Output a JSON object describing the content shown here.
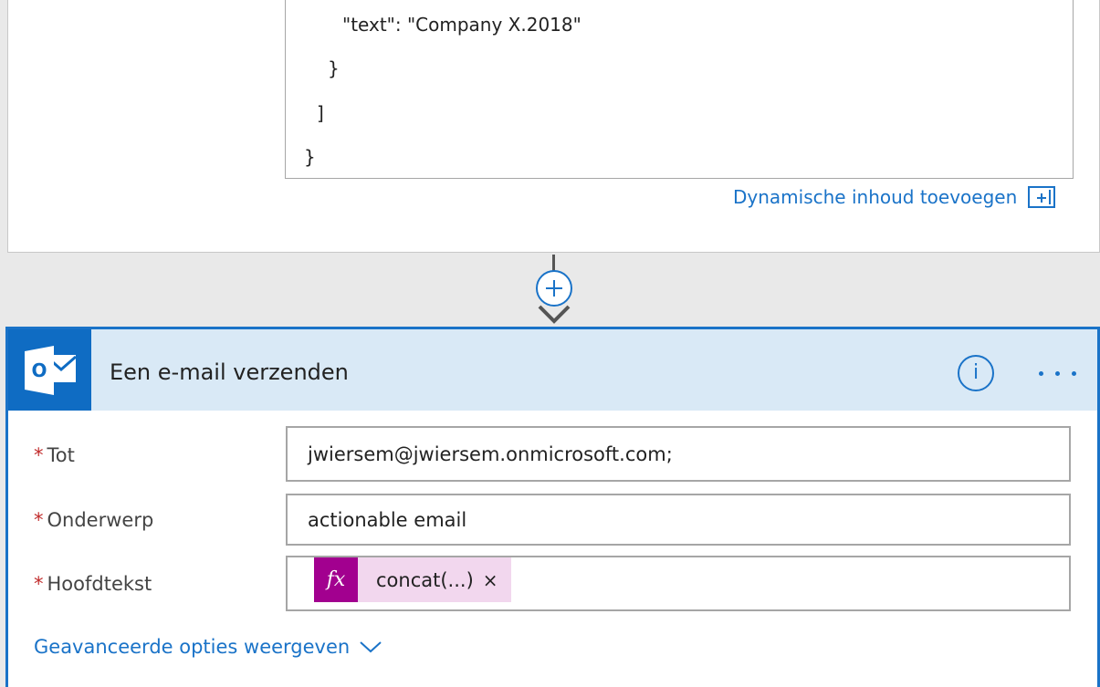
{
  "code": {
    "lines": [
      "\"text\": \"Company X.2018\"",
      "}",
      "]",
      "}"
    ]
  },
  "dynamic_content": {
    "label": "Dynamische inhoud toevoegen"
  },
  "mail_action": {
    "title": "Een e-mail verzenden",
    "info_symbol": "i",
    "logo_letter": "O",
    "fields": {
      "to": {
        "label": "Tot",
        "required_mark": "*",
        "value": "jwiersem@jwiersem.onmicrosoft.com;"
      },
      "subject": {
        "label": "Onderwerp",
        "required_mark": "*",
        "value": "actionable email"
      },
      "body": {
        "label": "Hoofdtekst",
        "required_mark": "*",
        "token_fx": "fx",
        "token_text": "concat(...)",
        "token_close": "×"
      }
    },
    "advanced_label": "Geavanceerde opties weergeven"
  },
  "colors": {
    "accent": "#1a73c8",
    "header_bg": "#d9e9f6",
    "outlook_blue": "#0f6cc3",
    "token_fx_bg": "#a2008f",
    "token_bg": "#f2d7ee",
    "required": "#c12d2d"
  }
}
